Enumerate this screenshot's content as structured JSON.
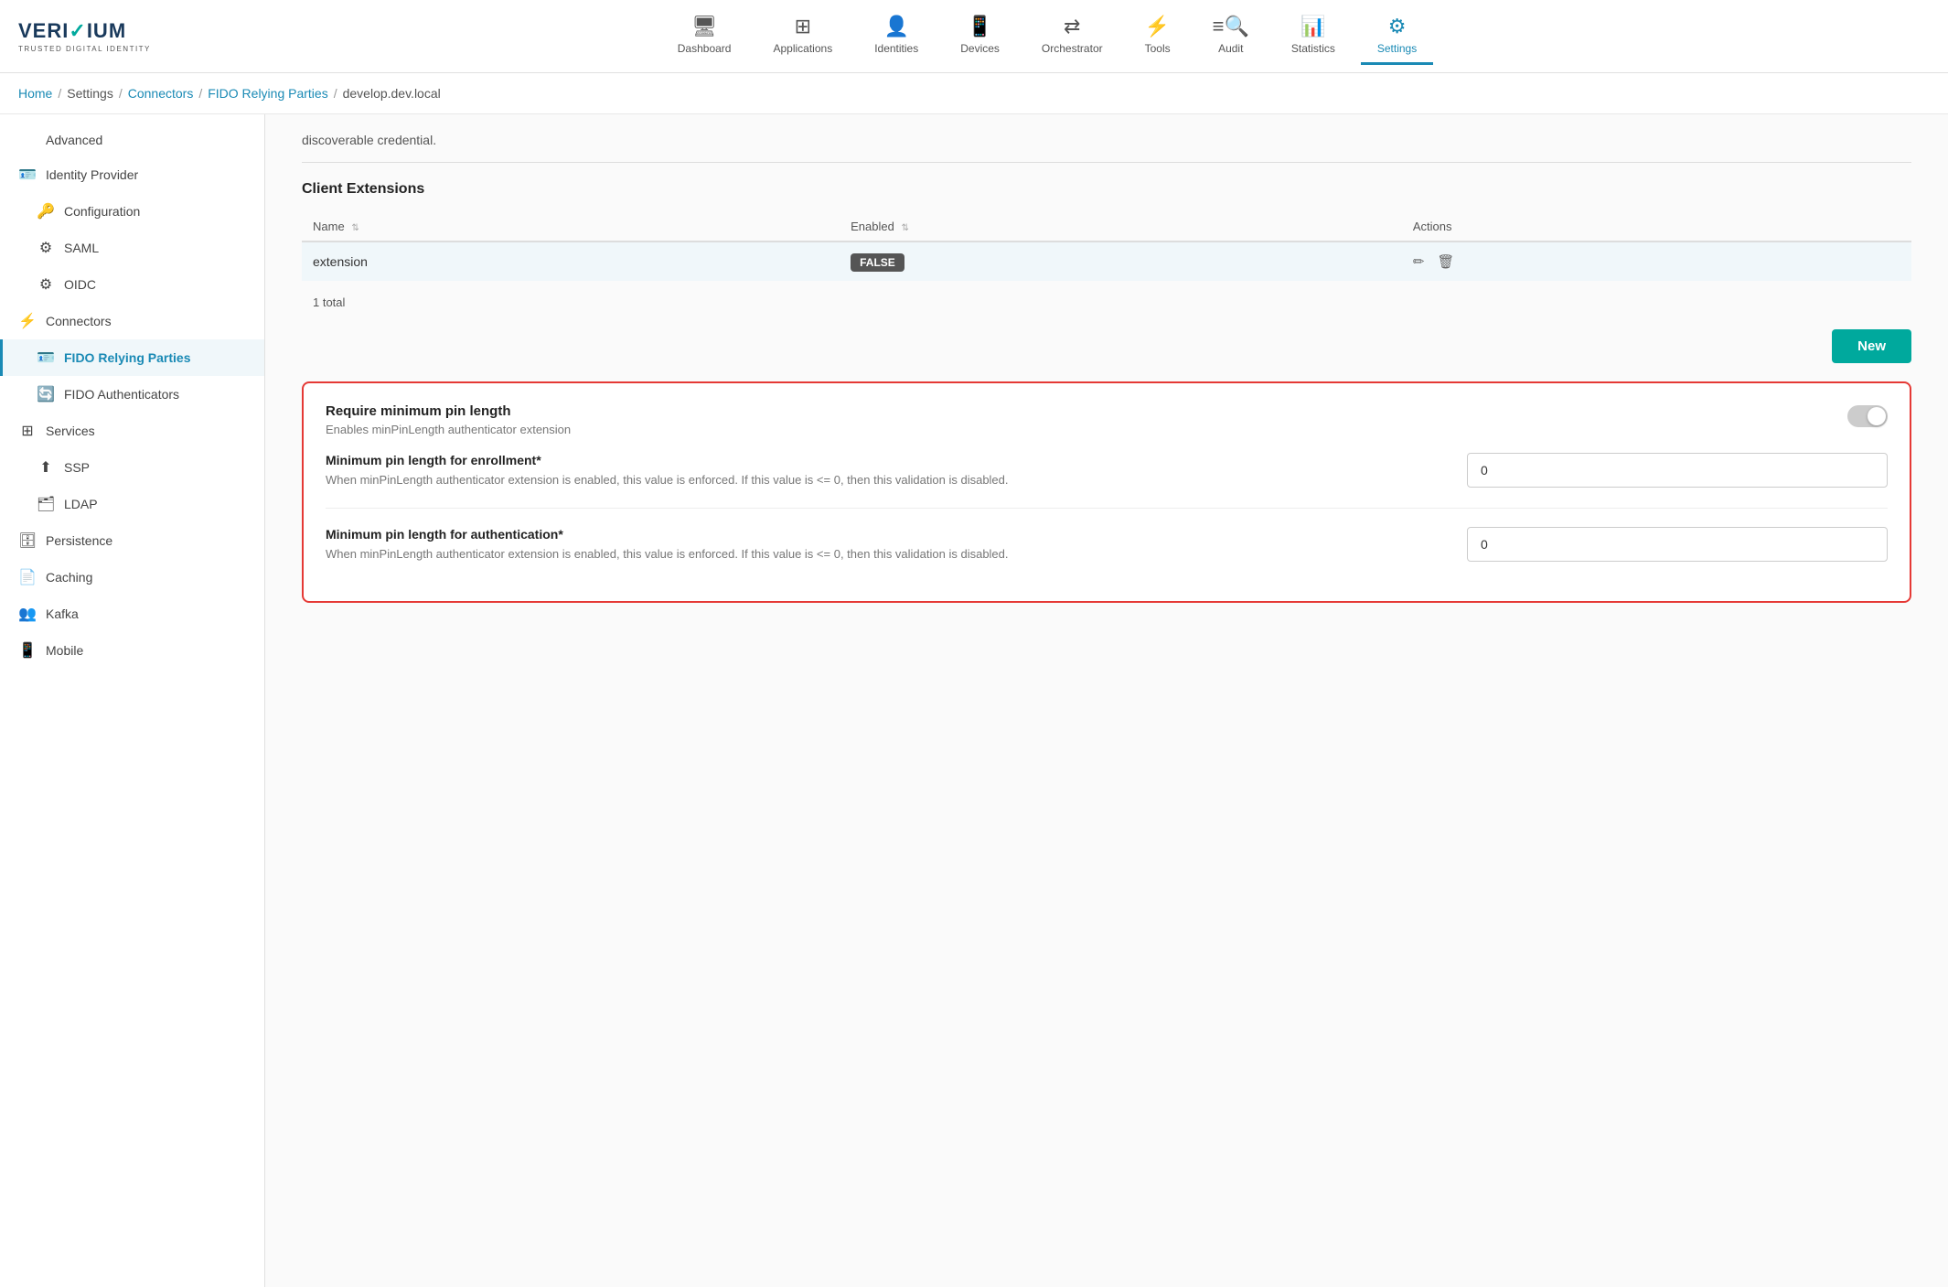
{
  "logo": {
    "name": "VERIDIUM",
    "tagline": "TRUSTED DIGITAL IDENTITY"
  },
  "nav": {
    "items": [
      {
        "id": "dashboard",
        "label": "Dashboard",
        "icon": "🖥"
      },
      {
        "id": "applications",
        "label": "Applications",
        "icon": "⊞"
      },
      {
        "id": "identities",
        "label": "Identities",
        "icon": "👤"
      },
      {
        "id": "devices",
        "label": "Devices",
        "icon": "📱"
      },
      {
        "id": "orchestrator",
        "label": "Orchestrator",
        "icon": "⇄"
      },
      {
        "id": "tools",
        "label": "Tools",
        "icon": "⚡"
      },
      {
        "id": "audit",
        "label": "Audit",
        "icon": "≡🔍"
      },
      {
        "id": "statistics",
        "label": "Statistics",
        "icon": "📊"
      },
      {
        "id": "settings",
        "label": "Settings",
        "icon": "⚙",
        "active": true
      }
    ]
  },
  "breadcrumb": {
    "items": [
      {
        "label": "Home",
        "link": true
      },
      {
        "label": "Settings",
        "link": false
      },
      {
        "label": "Connectors",
        "link": true
      },
      {
        "label": "FIDO Relying Parties",
        "link": true
      },
      {
        "label": "develop.dev.local",
        "link": false
      }
    ]
  },
  "sidebar": {
    "items": [
      {
        "id": "advanced",
        "label": "Advanced",
        "icon": "</>",
        "indent": 0
      },
      {
        "id": "identity-provider",
        "label": "Identity Provider",
        "icon": "🪪",
        "indent": 0
      },
      {
        "id": "configuration",
        "label": "Configuration",
        "icon": "🔑",
        "indent": 1
      },
      {
        "id": "saml",
        "label": "SAML",
        "icon": "⚙",
        "indent": 1
      },
      {
        "id": "oidc",
        "label": "OIDC",
        "icon": "⚙",
        "indent": 1
      },
      {
        "id": "connectors",
        "label": "Connectors",
        "icon": "⚡",
        "indent": 0
      },
      {
        "id": "fido-relying-parties",
        "label": "FIDO Relying Parties",
        "icon": "🪪",
        "indent": 1,
        "active": true
      },
      {
        "id": "fido-authenticators",
        "label": "FIDO Authenticators",
        "icon": "🔄",
        "indent": 1
      },
      {
        "id": "services",
        "label": "Services",
        "icon": "⊞",
        "indent": 0
      },
      {
        "id": "ssp",
        "label": "SSP",
        "icon": "⬆",
        "indent": 1
      },
      {
        "id": "ldap",
        "label": "LDAP",
        "icon": "🗂",
        "indent": 1
      },
      {
        "id": "persistence",
        "label": "Persistence",
        "icon": "🗄",
        "indent": 0
      },
      {
        "id": "caching",
        "label": "Caching",
        "icon": "📄",
        "indent": 0
      },
      {
        "id": "kafka",
        "label": "Kafka",
        "icon": "👥",
        "indent": 0
      },
      {
        "id": "mobile",
        "label": "Mobile",
        "icon": "📱",
        "indent": 0
      }
    ]
  },
  "content": {
    "note": "discoverable credential.",
    "client_extensions": {
      "title": "Client Extensions",
      "columns": [
        "Name",
        "Enabled",
        "Actions"
      ],
      "rows": [
        {
          "name": "extension",
          "enabled": "FALSE"
        }
      ],
      "total": "1 total"
    },
    "new_button": "New",
    "red_section": {
      "toggle": {
        "label": "Require minimum pin length",
        "description": "Enables minPinLength authenticator extension",
        "enabled": false
      },
      "fields": [
        {
          "label": "Minimum pin length for enrollment*",
          "description": "When minPinLength authenticator extension is enabled, this value is enforced. If this value is <= 0, then this validation is disabled.",
          "value": "0"
        },
        {
          "label": "Minimum pin length for authentication*",
          "description": "When minPinLength authenticator extension is enabled, this value is enforced. If this value is <= 0, then this validation is disabled.",
          "value": "0"
        }
      ]
    }
  }
}
